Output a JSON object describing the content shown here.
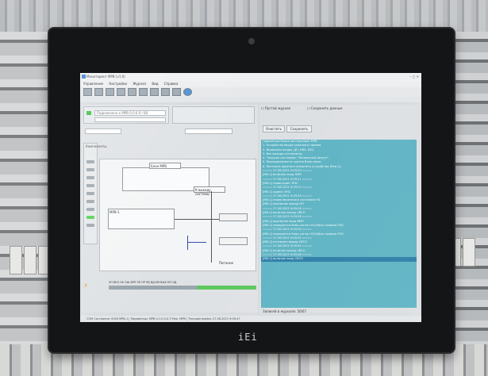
{
  "window": {
    "title": "Мониторинг МРВ (v1.0)",
    "menu": [
      "Управление",
      "Настройки",
      "Журнал",
      "Вид",
      "Справка"
    ]
  },
  "left": {
    "connection": "Подключено к MPB 0.0.0.0 / 80",
    "group_label": "Компоненты",
    "bem_label": "Блок МРВ",
    "exit_label": "К выходу системы",
    "mrv_label": "МРВ-1",
    "power_label": "Питание",
    "indicators": "ЭП  ВКЗ  ОК  ОШ  ВРП  ЗП  ПР  РД  ВД  МЭ  ВЫХ  НП  ОД"
  },
  "right": {
    "checkbox_1": "Пустой журнал",
    "checkbox_2": "Сохранять данные",
    "button_1": "Очистить",
    "button_2": "Сохранить",
    "log": [
      "Параметры блока контроллера МРВ:",
      "1. Устройство ввода каналов в приеме",
      "2. Включены входы: ДП, КВУ, КЗО,",
      "3. Все выходы отключены,",
      "4. Текущее состояние: \"Начальный запуск\",",
      "5. Принадлежности группе блок связи",
      "6. Контроль верхнего внешнего устройства (Реж.2).",
      "",
      "==== 27.08.2021 9:09:20 ====",
      "[МВ-1] включен вход ПМП",
      "==== 27.08.2021 9:09:21 ====",
      "[МВ-1] происходит ПНС",
      "==== 27.08.2021 9:09:22 ====",
      "[МВ-1] прием: ПНС",
      "==== 27.08.2021 9:09:23 ====",
      "[МВ-1] переключатели в состояние НС",
      "[МВ-1] выключен выход ОП",
      "==== 27.08.2021 9:09:26 ====",
      "[МВ-1] включен выход СВСО",
      "==== 27.08.2021 9:09:28 ====",
      "[МВ-1] выключен вход ВМП",
      "[МВ-1] передается блок-сигнал НС/сброс приема ПНС",
      "==== 27.08.2021 9:09:30 ====",
      "[МВ-1] передается блок-сигнал НС/сброс приема ПНС",
      "==== 27.08.2021 9:09:32 ====",
      "[МВ-1] отключен выход СВСО",
      "==== 27.08.2021 9:09:34 ====",
      "[МВ-1] включен выход СВСО",
      "==== 27.08.2021 9:09:46 ====",
      "[МВ-1] включен вход СВСО"
    ],
    "footer": "Записей в журнале: 56/67"
  },
  "statusbar": "COM Состояние: 0000 МРВ-1  |  Параметры: МРВ 0.1.0.0-0.3 Реж. МРВ  |  Текущее время: 27.08.2021 9:09:47",
  "logo": "iEi"
}
